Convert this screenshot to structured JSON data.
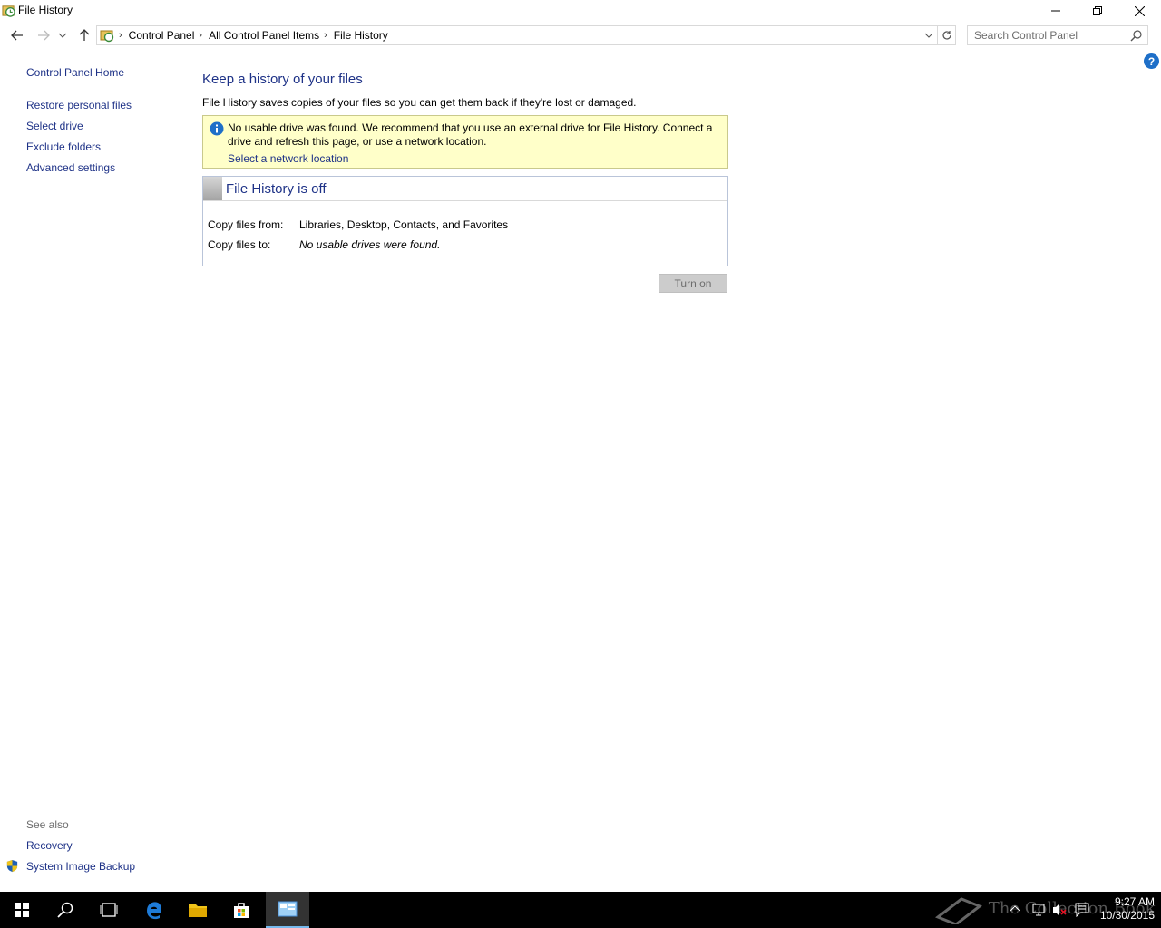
{
  "window": {
    "title": "File History"
  },
  "address": {
    "crumbs": [
      "Control Panel",
      "All Control Panel Items",
      "File History"
    ],
    "search_placeholder": "Search Control Panel"
  },
  "left_pane": {
    "home": "Control Panel Home",
    "links": [
      "Restore personal files",
      "Select drive",
      "Exclude folders",
      "Advanced settings"
    ],
    "see_also_title": "See also",
    "see_also": [
      "Recovery",
      "System Image Backup"
    ]
  },
  "main": {
    "heading": "Keep a history of your files",
    "description": "File History saves copies of your files so you can get them back if they're lost or damaged.",
    "info": {
      "text": "No usable drive was found. We recommend that you use an external drive for File History. Connect a drive and refresh this page, or use a network location.",
      "link": "Select a network location"
    },
    "status": {
      "title": "File History is off",
      "copy_from_label": "Copy files from:",
      "copy_from_value": "Libraries, Desktop, Contacts, and Favorites",
      "copy_to_label": "Copy files to:",
      "copy_to_value": "No usable drives were found."
    },
    "turn_on_label": "Turn on"
  },
  "help_label": "?",
  "taskbar": {
    "watermark": "The Collection Book",
    "time": "9:27 AM",
    "date": "10/30/2015",
    "accent": "#76b9ed"
  },
  "colors": {
    "link": "#1e3287",
    "info_bg": "#ffffc9",
    "taskbar_bg": "#000000"
  }
}
